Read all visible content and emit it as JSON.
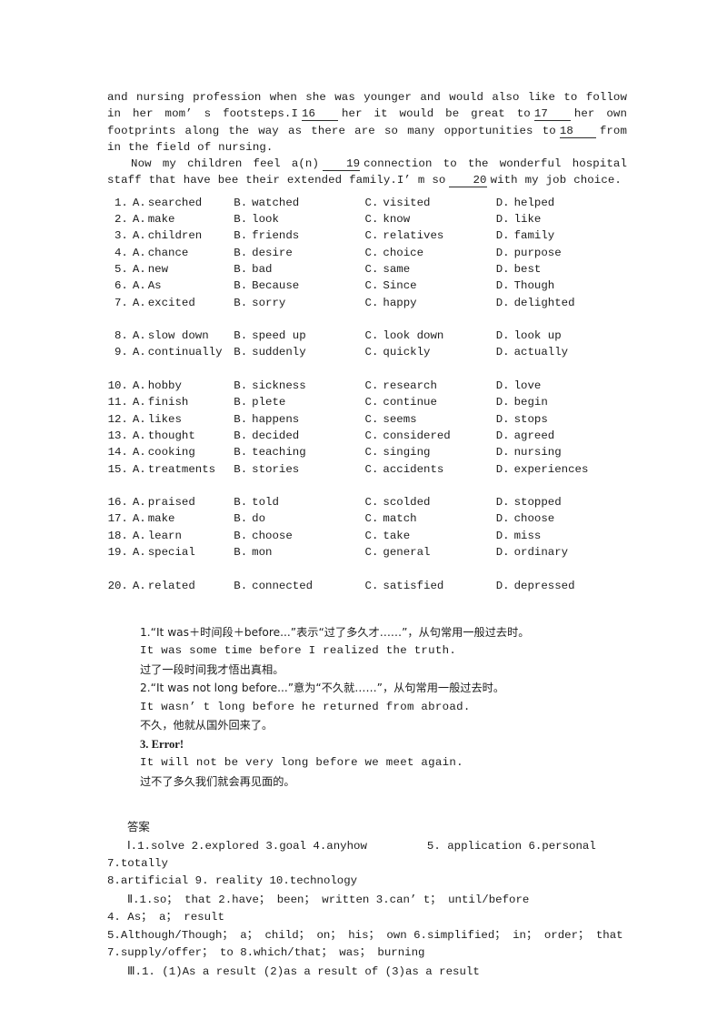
{
  "document": {
    "type": "english-exam-worksheet-page",
    "background_color": "#ffffff",
    "text_color": "#1c1c1c"
  },
  "passage": {
    "line1": "and nursing profession when she was younger and would also like to follow in",
    "line2_before": "her mom’ s footsteps.I",
    "blank_16": "16",
    "line2_mid": "her it would be great to",
    "blank_17": "17",
    "line2_after": "her own",
    "line3_before": "footprints along the way as there are so many opportunities to",
    "blank_18": "18",
    "line3_after": "from",
    "line4": "in the field of nursing.",
    "line5_before": "Now my children feel a(n)",
    "blank_19": "19",
    "line5_after": "connection to the wonderful hospital",
    "line6_before": "staff that have bee their extended family.I’ m so",
    "blank_20": "20",
    "line6_after": "with my job choice."
  },
  "options": {
    "letters": [
      "A.",
      "B.",
      "C.",
      "D."
    ],
    "groups": [
      {
        "gap_before": false,
        "rows": [
          {
            "num": "1.",
            "choices": [
              "searched",
              "watched",
              "visited",
              "helped"
            ]
          },
          {
            "num": "2.",
            "choices": [
              "make",
              "look",
              "know",
              "like"
            ]
          },
          {
            "num": "3.",
            "choices": [
              "children",
              "friends",
              "relatives",
              "family"
            ]
          },
          {
            "num": "4.",
            "choices": [
              "chance",
              "desire",
              "choice",
              "purpose"
            ]
          },
          {
            "num": "5.",
            "choices": [
              "new",
              "bad",
              "same",
              "best"
            ]
          },
          {
            "num": "6.",
            "choices": [
              "As",
              "Because",
              "Since",
              "Though"
            ]
          },
          {
            "num": "7.",
            "choices": [
              "excited",
              "sorry",
              "happy",
              "delighted"
            ]
          }
        ]
      },
      {
        "gap_before": true,
        "rows": [
          {
            "num": "8.",
            "choices": [
              "slow down",
              "speed up",
              "look down",
              "look up"
            ]
          },
          {
            "num": "9.",
            "choices": [
              "continually",
              "suddenly",
              "quickly",
              "actually"
            ]
          }
        ]
      },
      {
        "gap_before": true,
        "rows": [
          {
            "num": "10.",
            "choices": [
              "hobby",
              "sickness",
              "research",
              "love"
            ]
          },
          {
            "num": "11.",
            "choices": [
              "finish",
              "plete",
              "continue",
              "begin"
            ]
          },
          {
            "num": "12.",
            "choices": [
              "likes",
              "happens",
              "seems",
              "stops"
            ]
          },
          {
            "num": "13.",
            "choices": [
              "thought",
              "decided",
              "considered",
              "agreed"
            ]
          },
          {
            "num": "14.",
            "choices": [
              "cooking",
              "teaching",
              "singing",
              "nursing"
            ]
          },
          {
            "num": "15.",
            "choices": [
              "treatments",
              "stories",
              "accidents",
              "experiences"
            ]
          }
        ]
      },
      {
        "gap_before": true,
        "rows": [
          {
            "num": "16.",
            "choices": [
              "praised",
              "told",
              "scolded",
              "stopped"
            ]
          },
          {
            "num": "17.",
            "choices": [
              "make",
              "do",
              "match",
              "choose"
            ]
          },
          {
            "num": "18.",
            "choices": [
              "learn",
              "choose",
              "take",
              "miss"
            ]
          },
          {
            "num": "19.",
            "choices": [
              "special",
              "mon",
              "general",
              "ordinary"
            ]
          }
        ]
      },
      {
        "gap_before": true,
        "rows": [
          {
            "num": "20.",
            "choices": [
              "related",
              "connected",
              "satisfied",
              "depressed"
            ]
          }
        ]
      }
    ]
  },
  "notes": {
    "item1_cn": "1.“It was＋时间段＋before...”表示“过了多久才……”，从句常用一般过去时。",
    "item1_en": "It was some time before I realized the truth.",
    "item1_tr": "过了一段时间我才悟出真相。",
    "item2_cn": "2.“It was not long before...”意为“不久就……”，从句常用一般过去时。",
    "item2_en": "It wasn’ t long before he returned from abroad.",
    "item2_tr": "不久，他就从国外回来了。",
    "item3_label": "3. Error!",
    "item3_en": "It will not be very long before we meet again.",
    "item3_tr": "过不了多久我们就会再见面的。"
  },
  "answers": {
    "heading": "答案",
    "line1_roman": "Ⅰ",
    "line1_a": ".1.solve  2.explored  3.goal  4.anyhow",
    "line1_b": "5. application  6.personal",
    "line2": "7.totally",
    "line3": "8.artificial  9. reality  10.technology",
    "line4_roman": "Ⅱ",
    "line4": ".1.so； that  2.have； been； written  3.can’ t； until/before",
    "line5": "4. As； a； result",
    "line6": "5.Although/Though； a； child； on； his； own  6.simplified； in； order； that",
    "line7": "7.supply/offer； to  8.which/that； was； burning",
    "line8_roman": "Ⅲ",
    "line8": ".1. (1)As a result  (2)as a result of  (3)as a result"
  }
}
